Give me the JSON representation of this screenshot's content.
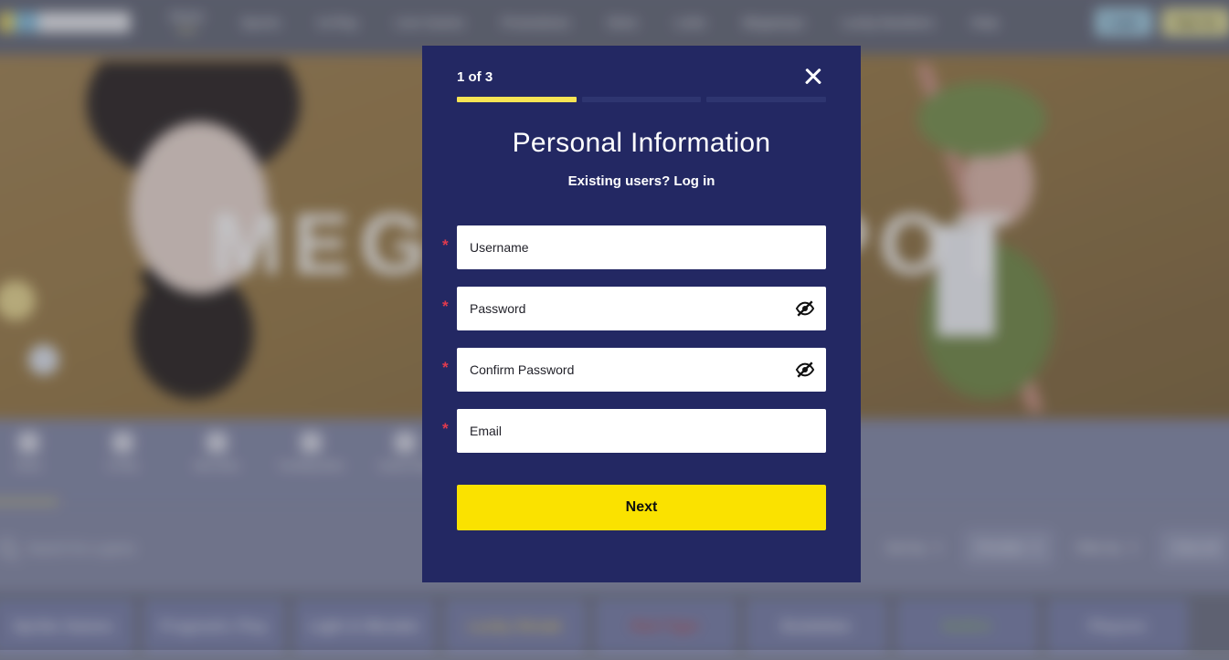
{
  "background": {
    "header": {
      "logo_name": "site-logo",
      "nav_items": [
        {
          "label": "Home",
          "sub": "NEW"
        },
        {
          "label": "Sports",
          "sub": ""
        },
        {
          "label": "In-Play",
          "sub": ""
        },
        {
          "label": "Live Casino",
          "sub": ""
        },
        {
          "label": "Promotions",
          "sub": ""
        },
        {
          "label": "Slots",
          "sub": ""
        },
        {
          "label": "Lotto",
          "sub": ""
        },
        {
          "label": "Megaways",
          "sub": ""
        },
        {
          "label": "Lucky Numbers",
          "sub": ""
        },
        {
          "label": "Help",
          "sub": ""
        }
      ],
      "login_label": "Login",
      "signup_label": "Sign Up"
    },
    "hero": {
      "headline": "MEGA JACKPOT"
    },
    "categories": [
      {
        "label": "Home",
        "icon": "home-icon"
      },
      {
        "label": "In-Play",
        "icon": "play-icon"
      },
      {
        "label": "New Slots",
        "icon": "star-icon"
      },
      {
        "label": "Trending Slots",
        "icon": "fire-icon"
      },
      {
        "label": "Casino Play",
        "icon": "cards-icon"
      }
    ],
    "search": {
      "placeholder": "Search for a game",
      "icon": "search-icon"
    },
    "filters": [
      {
        "label": "Sort by",
        "icon": "chevron-down-icon",
        "style": "plain"
      },
      {
        "label": "Provider",
        "icon": "chevron-down-icon",
        "style": "chip"
      },
      {
        "label": "Filter by",
        "icon": "chevron-down-icon",
        "style": "plain"
      },
      {
        "label": "Clear all",
        "icon": "",
        "style": "chip"
      }
    ],
    "provider_tiles": [
      {
        "name": "Spribe Games",
        "color": "#e8ecf6"
      },
      {
        "name": "Pragmatic Play",
        "color": "#dfe5f2"
      },
      {
        "name": "Light & Wonder",
        "color": "#eaeef7"
      },
      {
        "name": "Lucky Streak",
        "color": "#f2d24a"
      },
      {
        "name": "Red Tiger",
        "color": "#d8524e"
      },
      {
        "name": "Evolution",
        "color": "#f3f5fa"
      },
      {
        "name": "NetEnt",
        "color": "#8cc152"
      },
      {
        "name": "Playson",
        "color": "#e3e7f2"
      }
    ]
  },
  "modal": {
    "step_counter": "1 of 3",
    "close_icon": "close-icon",
    "progress": {
      "total_steps": 3,
      "current_step": 1
    },
    "title": "Personal Information",
    "subtitle": "Existing users? Log in",
    "required_marker": "*",
    "fields": [
      {
        "name": "username",
        "placeholder": "Username",
        "value": "",
        "required": true,
        "type": "text",
        "has_toggle": false
      },
      {
        "name": "password",
        "placeholder": "Password",
        "value": "",
        "required": true,
        "type": "password",
        "has_toggle": true,
        "toggle_icon": "eye-slash-icon"
      },
      {
        "name": "confirm-password",
        "placeholder": "Confirm Password",
        "value": "",
        "required": true,
        "type": "password",
        "has_toggle": true,
        "toggle_icon": "eye-slash-icon"
      },
      {
        "name": "email",
        "placeholder": "Email",
        "value": "",
        "required": true,
        "type": "email",
        "has_toggle": false
      }
    ],
    "next_label": "Next"
  },
  "colors": {
    "modal_bg": "#232863",
    "accent_yellow": "#fae200",
    "progress_filled": "#f7e454",
    "progress_empty": "#2e3570",
    "required_red": "#e03a4e",
    "text_white": "#ffffff"
  }
}
